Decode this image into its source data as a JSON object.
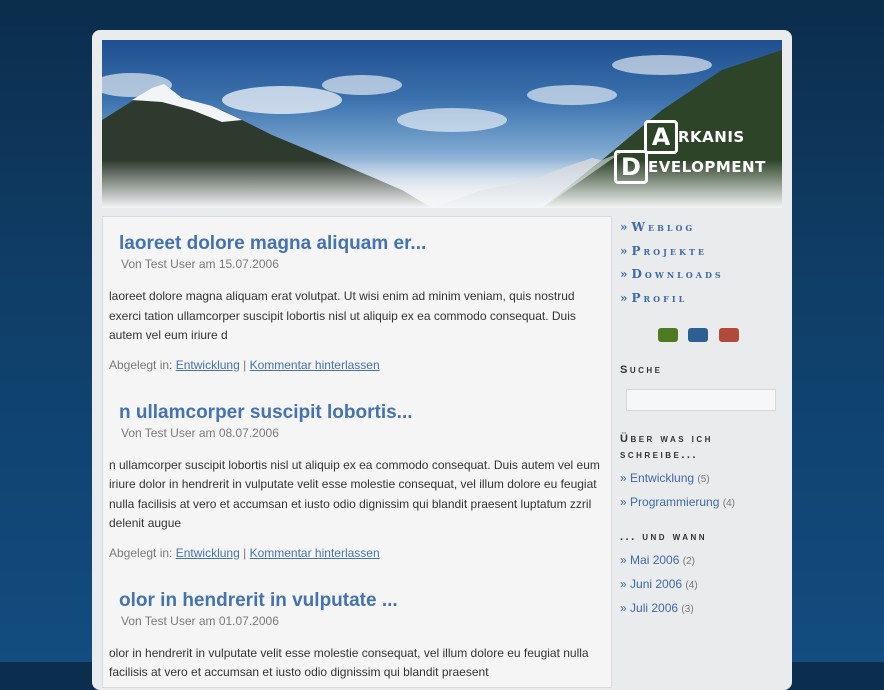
{
  "logo": {
    "letter1": "A",
    "word1": "RKANIS",
    "letter2": "D",
    "word2": "EVELOPMENT"
  },
  "posts": [
    {
      "title": "laoreet dolore magna aliquam er...",
      "meta": "Von Test User am 15.07.2006",
      "body": "laoreet dolore magna aliquam erat volutpat. Ut wisi enim ad minim veniam, quis nostrud exerci tation ullamcorper suscipit lobortis nisl ut aliquip ex ea commodo consequat. Duis autem vel eum iriure d",
      "filed_label": "Abgelegt in:",
      "category": "Entwicklung",
      "separator": "|",
      "comment": "Kommentar hinterlassen"
    },
    {
      "title": "n ullamcorper suscipit lobortis...",
      "meta": "Von Test User am 08.07.2006",
      "body": "n ullamcorper suscipit lobortis nisl ut aliquip ex ea commodo consequat. Duis autem vel eum iriure dolor in hendrerit in vulputate velit esse molestie consequat, vel illum dolore eu feugiat nulla facilisis at vero et accumsan et iusto odio dignissim qui blandit praesent luptatum zzril delenit augue",
      "filed_label": "Abgelegt in:",
      "category": "Entwicklung",
      "separator": "|",
      "comment": "Kommentar hinterlassen"
    },
    {
      "title": "olor in hendrerit in vulputate ...",
      "meta": "Von Test User am 01.07.2006",
      "body": "olor in hendrerit in vulputate velit esse molestie consequat, vel illum dolore eu feugiat nulla facilisis at vero et accumsan et iusto odio dignissim qui blandit praesent"
    }
  ],
  "nav": {
    "arrow": "»",
    "items": [
      "Weblog",
      "Projekte",
      "Downloads",
      "Profil"
    ]
  },
  "themes": [
    {
      "name": "green-theme-button",
      "color": "#4d7a22"
    },
    {
      "name": "blue-theme-button",
      "color": "#2d5f93"
    },
    {
      "name": "red-theme-button",
      "color": "#b24a3c"
    }
  ],
  "search": {
    "heading": "Suche",
    "value": ""
  },
  "topics": {
    "heading_line1": "Über was ich",
    "heading_line2": "schreibe...",
    "items": [
      {
        "label": "Entwicklung",
        "count": "(5)"
      },
      {
        "label": "Programmierung",
        "count": "(4)"
      }
    ]
  },
  "archive": {
    "heading": "... und wann",
    "items": [
      {
        "label": "Mai 2006",
        "count": "(2)"
      },
      {
        "label": "Juni 2006",
        "count": "(4)"
      },
      {
        "label": "Juli 2006",
        "count": "(3)"
      }
    ]
  }
}
